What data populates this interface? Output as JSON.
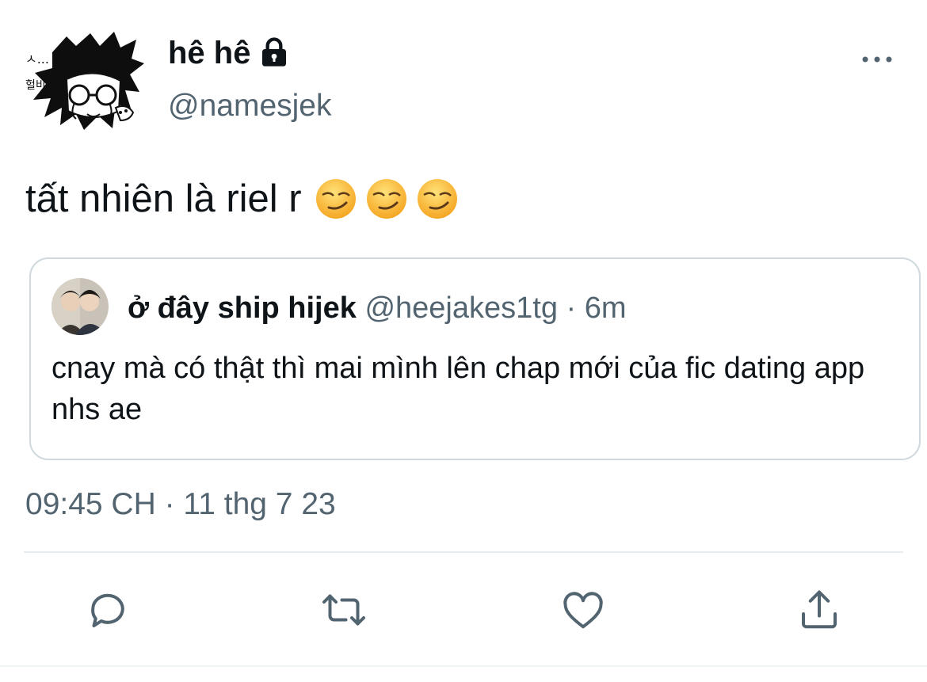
{
  "header": {
    "display_name": "hê hê",
    "handle": "@namesjek",
    "avatar_icon": "sketch-avatar",
    "lock_icon": "lock-icon",
    "more_icon": "more-horizontal-icon"
  },
  "tweet": {
    "text": "tất nhiên là riel r",
    "emojis": [
      "smirking-face",
      "smirking-face",
      "smirking-face"
    ]
  },
  "quoted_tweet": {
    "display_name": "ở đây ship hijek",
    "handle": "@heejakes1tg",
    "separator": "·",
    "time_ago": "6m",
    "text": "cnay mà có thật thì mai mình lên chap mới của fic dating app nhs ae"
  },
  "timestamp": "09:45 CH · 11 thg 7 23",
  "actions": {
    "reply_icon": "reply-icon",
    "retweet_icon": "retweet-icon",
    "like_icon": "heart-icon",
    "share_icon": "share-icon"
  },
  "colors": {
    "text_primary": "#0f1419",
    "text_secondary": "#536471",
    "border": "#cfd9de",
    "icon": "#536471"
  }
}
